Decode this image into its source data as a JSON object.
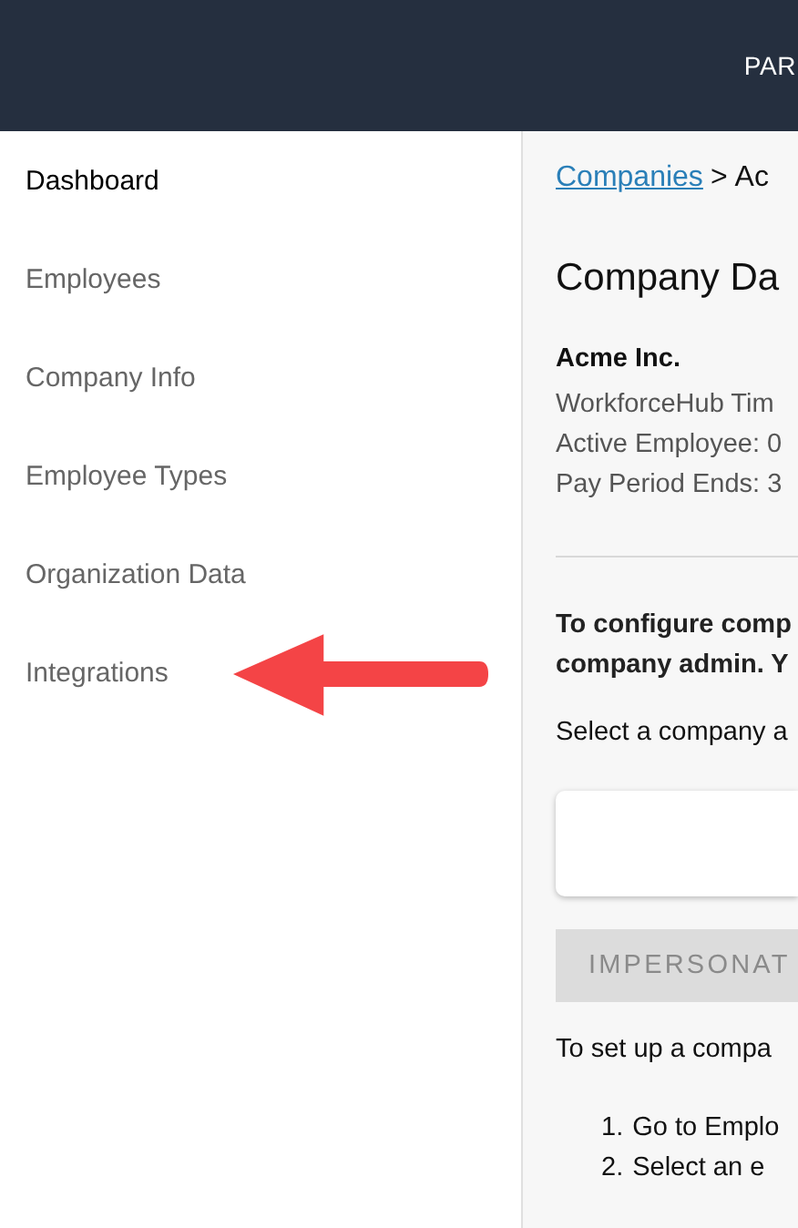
{
  "header": {
    "nav_label": "PAR"
  },
  "sidebar": {
    "items": [
      {
        "label": "Dashboard",
        "selected": true
      },
      {
        "label": "Employees",
        "selected": false
      },
      {
        "label": "Company Info",
        "selected": false
      },
      {
        "label": "Employee Types",
        "selected": false
      },
      {
        "label": "Organization Data",
        "selected": false
      },
      {
        "label": "Integrations",
        "selected": false
      }
    ]
  },
  "breadcrumb": {
    "link": "Companies",
    "separator": ">",
    "current": "Ac"
  },
  "title": "Company Da",
  "company": {
    "name": "Acme Inc.",
    "lines": [
      "WorkforceHub Tim",
      "Active Employee: 0",
      "Pay Period Ends: 3"
    ]
  },
  "instructions": [
    "To configure comp",
    "company admin. Y"
  ],
  "select_label": "Select a company a",
  "impersonate_button": {
    "label": "IMPERSONAT",
    "disabled": true
  },
  "setup_text": "To set up a compa",
  "steps": [
    {
      "number": "1.",
      "text": "Go to Emplo"
    },
    {
      "number": "2.",
      "text": "Select an e"
    }
  ]
}
